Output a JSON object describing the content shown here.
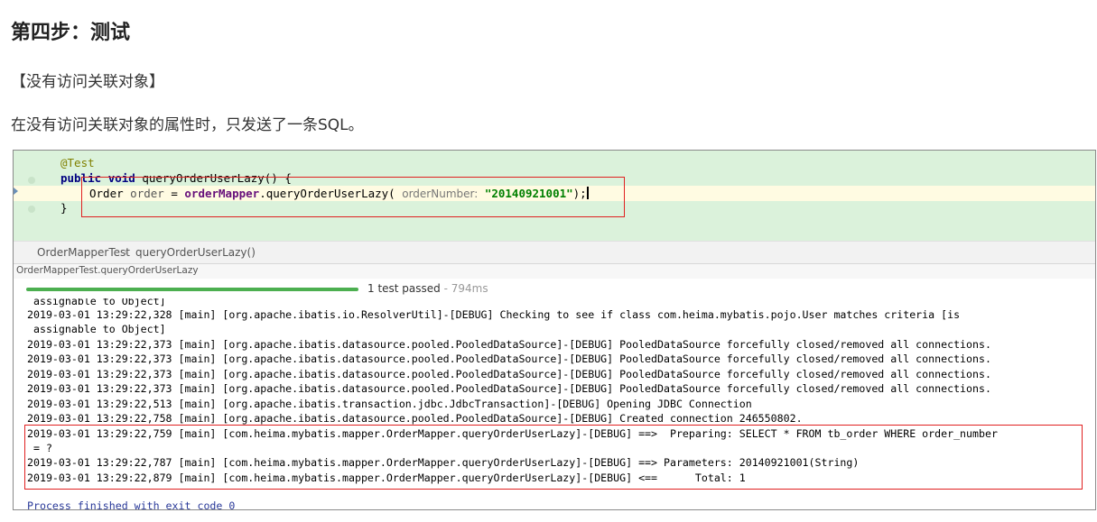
{
  "heading": "第四步：测试",
  "subtitle": "【没有访问关联对象】",
  "description": "在没有访问关联对象的属性时，只发送了一条SQL。",
  "editor": {
    "annotation": "@Test",
    "kw_public": "public",
    "kw_void": "void",
    "method_sig": " queryOrderUserLazy() {",
    "type_name": "Order",
    "var_name": "order",
    "eq": " = ",
    "mapper_field": "orderMapper",
    "call": ".queryOrderUserLazy( ",
    "param_hint": "orderNumber:",
    "arg": "\"20140921001\"",
    "tail": ");",
    "close": "}"
  },
  "breadcrumb": {
    "class": "OrderMapperTest",
    "separator": "›",
    "method": "queryOrderUserLazy()"
  },
  "run_tab": "OrderMapperTest.queryOrderUserLazy",
  "status": {
    "passed": "1 test passed",
    "time": " - 794ms",
    "progress_fraction": 1.0
  },
  "console_lines": [
    " assignable to Object]",
    "2019-03-01 13:29:22,328 [main] [org.apache.ibatis.io.ResolverUtil]-[DEBUG] Checking to see if class com.heima.mybatis.pojo.User matches criteria [is",
    " assignable to Object]",
    "2019-03-01 13:29:22,373 [main] [org.apache.ibatis.datasource.pooled.PooledDataSource]-[DEBUG] PooledDataSource forcefully closed/removed all connections.",
    "2019-03-01 13:29:22,373 [main] [org.apache.ibatis.datasource.pooled.PooledDataSource]-[DEBUG] PooledDataSource forcefully closed/removed all connections.",
    "2019-03-01 13:29:22,373 [main] [org.apache.ibatis.datasource.pooled.PooledDataSource]-[DEBUG] PooledDataSource forcefully closed/removed all connections.",
    "2019-03-01 13:29:22,373 [main] [org.apache.ibatis.datasource.pooled.PooledDataSource]-[DEBUG] PooledDataSource forcefully closed/removed all connections.",
    "2019-03-01 13:29:22,513 [main] [org.apache.ibatis.transaction.jdbc.JdbcTransaction]-[DEBUG] Opening JDBC Connection",
    "2019-03-01 13:29:22,758 [main] [org.apache.ibatis.datasource.pooled.PooledDataSource]-[DEBUG] Created connection 246550802.",
    "2019-03-01 13:29:22,759 [main] [com.heima.mybatis.mapper.OrderMapper.queryOrderUserLazy]-[DEBUG] ==>  Preparing: SELECT * FROM tb_order WHERE order_number",
    " = ?",
    "2019-03-01 13:29:22,787 [main] [com.heima.mybatis.mapper.OrderMapper.queryOrderUserLazy]-[DEBUG] ==> Parameters: 20140921001(String)",
    "2019-03-01 13:29:22,879 [main] [com.heima.mybatis.mapper.OrderMapper.queryOrderUserLazy]-[DEBUG] <==      Total: 1",
    "",
    "Process finished with exit code 0"
  ],
  "colors": {
    "editor_bg": "#dbf2db",
    "highlight_box": "#e02020",
    "progress": "#4caf50"
  }
}
